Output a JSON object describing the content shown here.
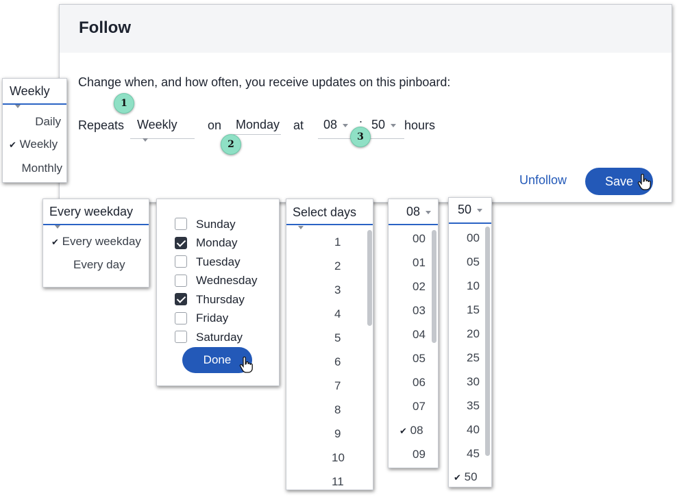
{
  "dialog": {
    "title": "Follow",
    "description": "Change when, and how often, you receive updates on this pinboard:",
    "repeats_label": "Repeats",
    "frequency_value": "Weekly",
    "on_label": "on",
    "day_value": "Monday",
    "at_label": "at",
    "hour_value": "08",
    "separator": ":",
    "minute_value": "50",
    "hours_label": "hours",
    "unfollow_label": "Unfollow",
    "save_label": "Save"
  },
  "frequency_dropdown": {
    "selected": "Weekly",
    "options": [
      "Daily",
      "Weekly",
      "Monthly"
    ]
  },
  "weekday_dropdown": {
    "selected": "Every weekday",
    "options": [
      "Every weekday",
      "Every day"
    ]
  },
  "days_checklist": {
    "items": [
      {
        "label": "Sunday",
        "checked": false
      },
      {
        "label": "Monday",
        "checked": true
      },
      {
        "label": "Tuesday",
        "checked": false
      },
      {
        "label": "Wednesday",
        "checked": false
      },
      {
        "label": "Thursday",
        "checked": true
      },
      {
        "label": "Friday",
        "checked": false
      },
      {
        "label": "Saturday",
        "checked": false
      }
    ],
    "done_label": "Done"
  },
  "select_days_dropdown": {
    "placeholder": "Select days",
    "options": [
      "1",
      "2",
      "3",
      "4",
      "5",
      "6",
      "7",
      "8",
      "9",
      "10",
      "11"
    ]
  },
  "hour_dropdown": {
    "selected": "08",
    "options": [
      "00",
      "01",
      "02",
      "03",
      "04",
      "05",
      "06",
      "07",
      "08",
      "09"
    ]
  },
  "minute_dropdown": {
    "selected": "50",
    "options": [
      "00",
      "05",
      "10",
      "15",
      "20",
      "25",
      "30",
      "35",
      "40",
      "45",
      "50"
    ]
  },
  "callouts": [
    "1",
    "2",
    "3"
  ],
  "check_mark": "✔",
  "colors": {
    "accent": "#2359b8",
    "callout": "#8fe0c5",
    "arrow": "#8fdcc0"
  }
}
